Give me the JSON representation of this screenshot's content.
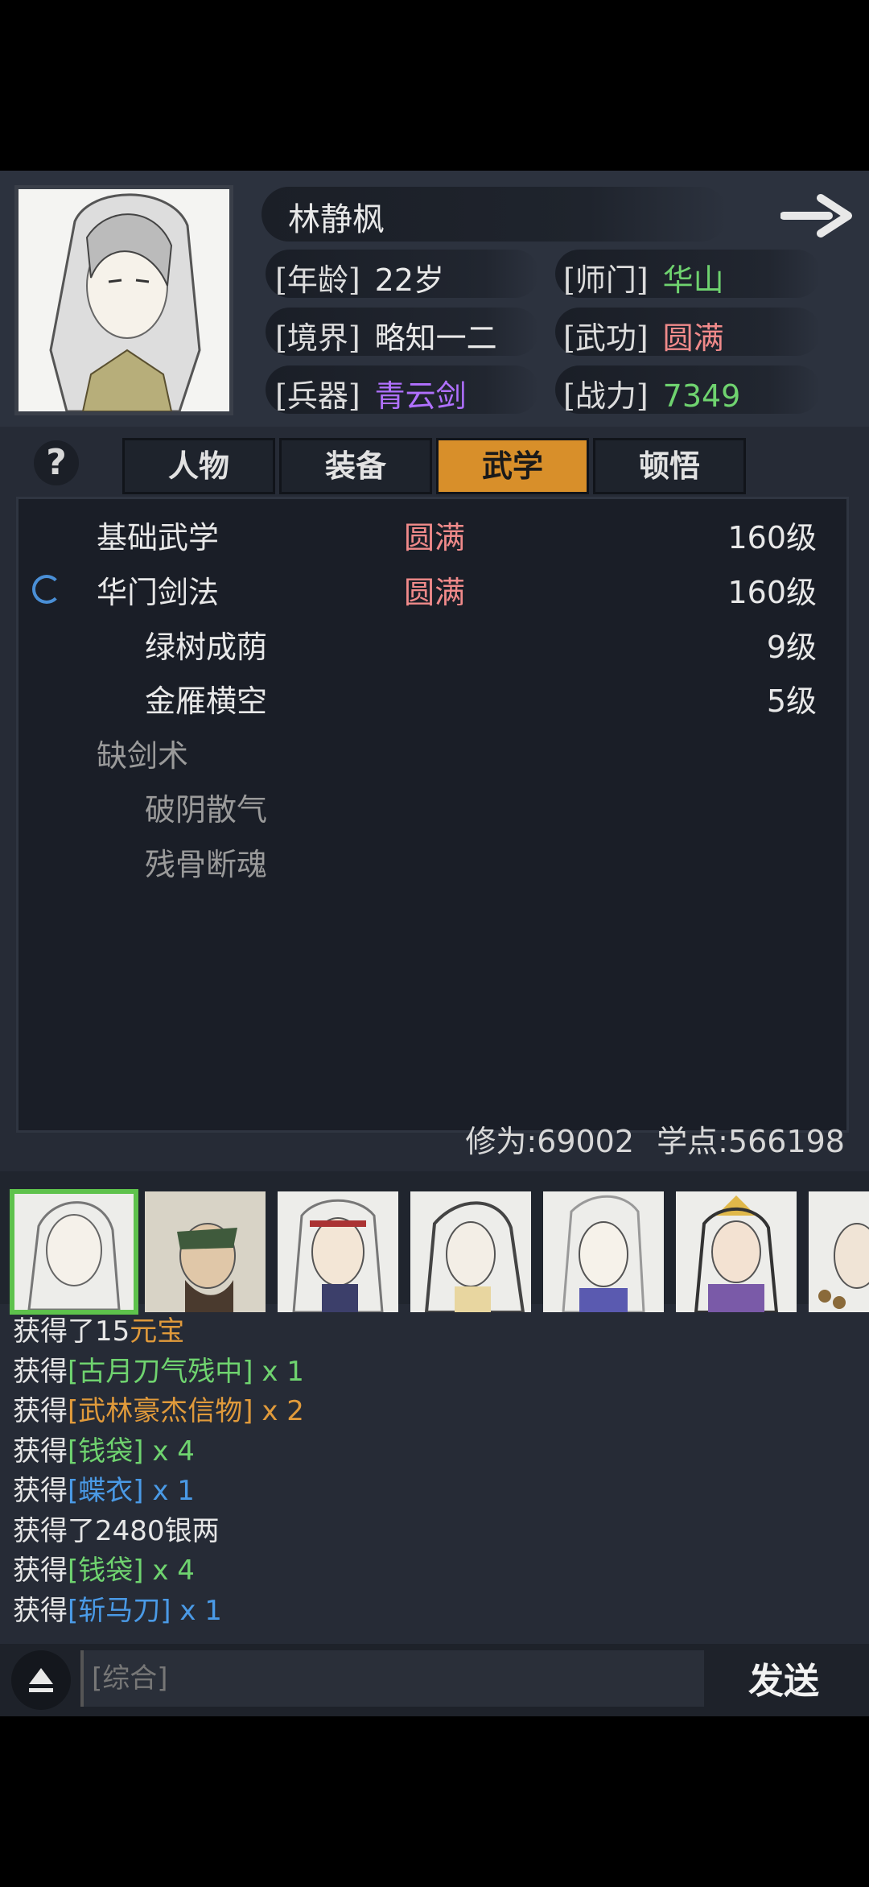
{
  "character": {
    "name": "林静枫",
    "age_label": "[年龄]",
    "age": "22岁",
    "sect_label": "[师门]",
    "sect": "华山",
    "realm_label": "[境界]",
    "realm": "略知一二",
    "martial_label": "[武功]",
    "martial": "圆满",
    "weapon_label": "[兵器]",
    "weapon": "青云剑",
    "power_label": "[战力]",
    "power": "7349"
  },
  "tabs": [
    {
      "label": "人物"
    },
    {
      "label": "装备"
    },
    {
      "label": "武学",
      "active": true
    },
    {
      "label": "顿悟"
    }
  ],
  "help_label": "?",
  "skills": [
    {
      "name": "基础武学",
      "status": "圆满",
      "level": "160级"
    },
    {
      "name": "华门剑法",
      "status": "圆满",
      "level": "160级"
    },
    {
      "name": "绿树成荫",
      "status": "",
      "level": "9级"
    },
    {
      "name": "金雁横空",
      "status": "",
      "level": "5级"
    },
    {
      "name": "缺剑术",
      "status": "",
      "level": ""
    },
    {
      "name": "破阴散气",
      "status": "",
      "level": ""
    },
    {
      "name": "残骨断魂",
      "status": "",
      "level": ""
    }
  ],
  "stats": {
    "cultivation": "修为:69002",
    "points": "学点:566198"
  },
  "log": [
    {
      "prefix": "获得了15",
      "item": "元宝",
      "suffix": ""
    },
    {
      "prefix": "获得",
      "item": "[古月刀气残中]",
      "suffix": " x 1"
    },
    {
      "prefix": "获得",
      "item": "[武林豪杰信物]",
      "suffix": " x 2"
    },
    {
      "prefix": "获得",
      "item": "[钱袋]",
      "suffix": " x 4"
    },
    {
      "prefix": "获得",
      "item": "[蝶衣]",
      "suffix": " x 1"
    },
    {
      "prefix": "获得了2480银两",
      "item": "",
      "suffix": ""
    },
    {
      "prefix": "获得",
      "item": "[钱袋]",
      "suffix": " x 4"
    },
    {
      "prefix": "获得",
      "item": "[斩马刀]",
      "suffix": " x 1"
    }
  ],
  "chat": {
    "placeholder": "[综合]",
    "send_label": "发送"
  },
  "icons": {
    "forward": "arrow-right-icon",
    "expand": "triangle-up-icon",
    "loading": "spinner-icon"
  },
  "colors": {
    "accent_tab": "#d88f2a",
    "green": "#6fd36f",
    "pink": "#f08a8a",
    "purple": "#b070ff",
    "orange": "#e09a3b",
    "blue": "#4a9ae6"
  }
}
